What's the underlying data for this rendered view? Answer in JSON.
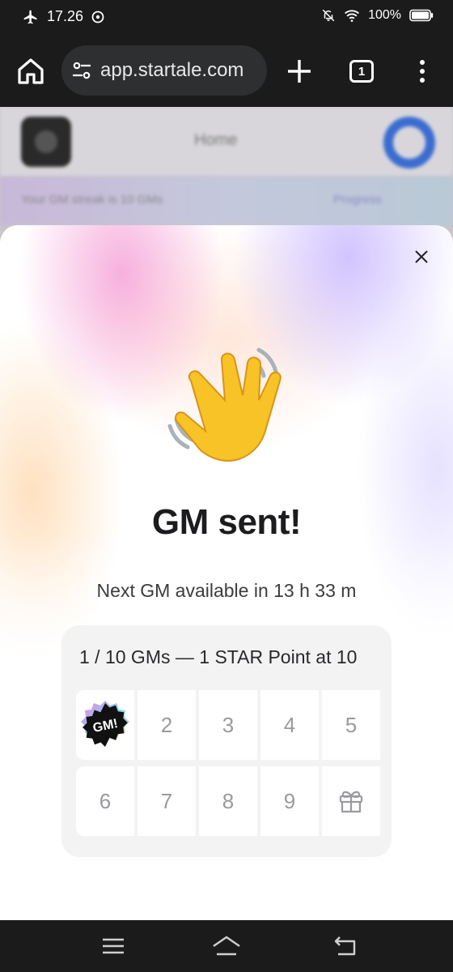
{
  "status_bar": {
    "time": "17.26",
    "battery": "100%",
    "icons": [
      "airplane-icon",
      "settings-badge-icon",
      "mute-icon",
      "wifi-icon",
      "battery-icon"
    ]
  },
  "browser": {
    "url": "app.startale.com",
    "tab_count": "1",
    "icons": [
      "home-icon",
      "site-settings-icon",
      "plus-icon",
      "tabs-icon",
      "more-vert-icon"
    ]
  },
  "background_page": {
    "title": "Home",
    "banner_text": "Your GM streak is 10 GMs",
    "banner_link": "Progress"
  },
  "modal": {
    "title": "GM sent!",
    "subtitle": "Next GM available in 13 h 33 m",
    "progress_title": "1 / 10 GMs — 1 STAR Point at 10",
    "badge_text": "GM!",
    "days_row1": [
      "2",
      "3",
      "4",
      "5"
    ],
    "days_row2": [
      "6",
      "7",
      "8",
      "9"
    ],
    "completed": 1,
    "total": 10,
    "accent": "#1c1c1e"
  },
  "nav": {
    "icons": [
      "recents-icon",
      "home-nav-icon",
      "back-icon"
    ]
  }
}
